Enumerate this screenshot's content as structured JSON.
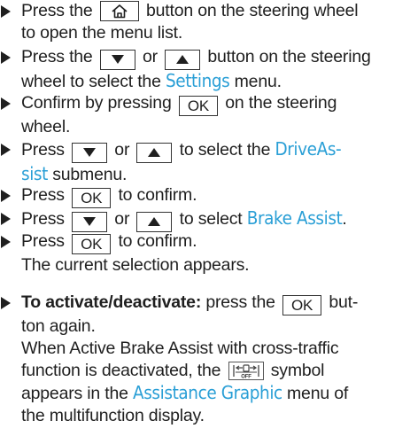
{
  "steps": [
    {
      "lines": [
        [
          "Press the ",
          "{home}",
          " button on the steering wheel"
        ],
        [
          "to open the menu list."
        ]
      ]
    },
    {
      "lines": [
        [
          "Press the ",
          "{down}",
          " or ",
          "{up}",
          " button on the steering"
        ],
        [
          "wheel to select the ",
          "[Settings]",
          " menu."
        ]
      ]
    },
    {
      "lines": [
        [
          "Confirm by pressing ",
          "{OK}",
          " on the steering"
        ],
        [
          "wheel."
        ]
      ]
    },
    {
      "lines": [
        [
          "Press ",
          "{down}",
          " or ",
          "{up}",
          " to select the ",
          "[DriveAs-]"
        ],
        [
          "[sist]",
          " submenu."
        ]
      ]
    },
    {
      "lines": [
        [
          "Press ",
          "{OK}",
          " to confirm."
        ]
      ]
    },
    {
      "lines": [
        [
          "Press ",
          "{down}",
          " or ",
          "{up}",
          " to select ",
          "[Brake Assist]",
          "."
        ]
      ]
    },
    {
      "lines": [
        [
          "Press ",
          "{OK}",
          " to confirm."
        ],
        [
          "The current selection appears."
        ]
      ]
    },
    {
      "lines": [
        [
          "*To activate/deactivate:*",
          " press the ",
          "{OK}",
          " but-"
        ],
        [
          "ton again."
        ],
        [
          "When Active Brake Assist with cross-traffic"
        ],
        [
          "function is deactivated, the ",
          "{off}",
          " symbol"
        ],
        [
          "appears in the ",
          "[Assistance Graphic]",
          " menu of"
        ],
        [
          "the multifunction display."
        ]
      ]
    }
  ],
  "buttons": {
    "OK": "OK",
    "home": "home-icon",
    "down": "down-triangle-icon",
    "up": "up-triangle-icon",
    "off": "OFF"
  },
  "colors": {
    "menu_text": "#2a9fd6",
    "body_text": "#1f1f1f"
  }
}
